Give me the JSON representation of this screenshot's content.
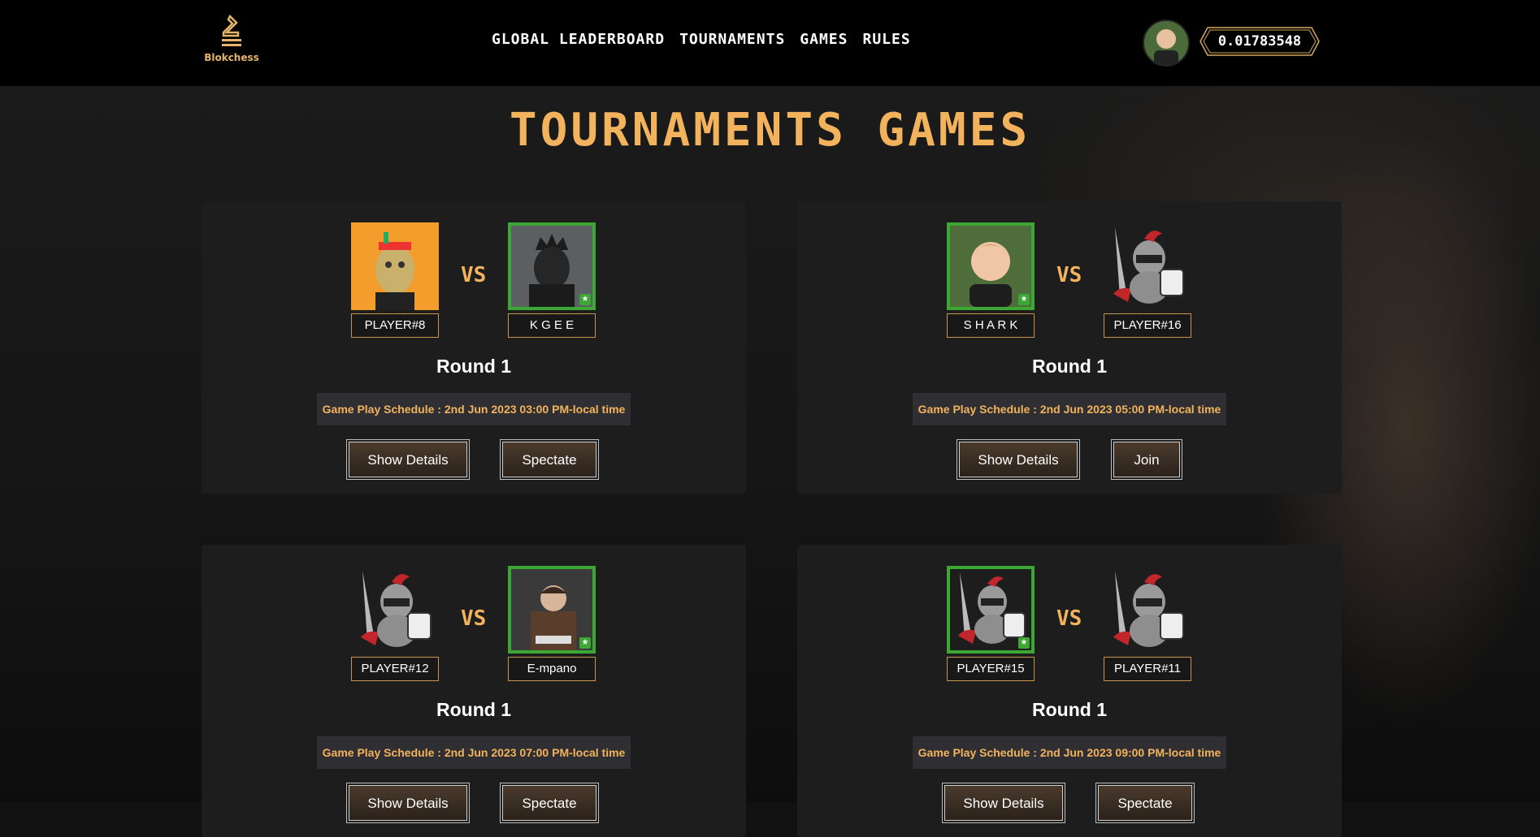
{
  "header": {
    "logo_text": "Blokchess",
    "nav": [
      "GLOBAL LEADERBOARD",
      "TOURNAMENTS",
      "GAMES",
      "RULES"
    ],
    "balance": "0.01783548"
  },
  "page": {
    "title": "TOURNAMENTS GAMES"
  },
  "games": [
    {
      "p1": "PLAYER#8",
      "p2": "K G E E",
      "winner": "p2",
      "vs": "VS",
      "round": "Round 1",
      "schedule": "Game Play Schedule : 2nd Jun 2023 03:00 PM-local time",
      "btn1": "Show Details",
      "btn2": "Spectate"
    },
    {
      "p1": "S H A R K",
      "p2": "PLAYER#16",
      "winner": "p1",
      "vs": "VS",
      "round": "Round 1",
      "schedule": "Game Play Schedule : 2nd Jun 2023 05:00 PM-local time",
      "btn1": "Show Details",
      "btn2": "Join"
    },
    {
      "p1": "PLAYER#12",
      "p2": "E-mpano",
      "winner": "p2",
      "vs": "VS",
      "round": "Round 1",
      "schedule": "Game Play Schedule : 2nd Jun 2023 07:00 PM-local time",
      "btn1": "Show Details",
      "btn2": "Spectate"
    },
    {
      "p1": "PLAYER#15",
      "p2": "PLAYER#11",
      "winner": "p1",
      "vs": "VS",
      "round": "Round 1",
      "schedule": "Game Play Schedule : 2nd Jun 2023 09:00 PM-local time",
      "btn1": "Show Details",
      "btn2": "Spectate"
    }
  ],
  "icons": {
    "logo": "knight-logo-icon",
    "trophy": "trophy-icon"
  },
  "colors": {
    "accent": "#f2b35c",
    "winner_border": "#3aa832",
    "card_bg": "#1d1d1e"
  }
}
